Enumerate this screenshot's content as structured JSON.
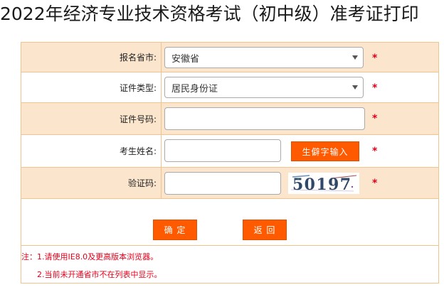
{
  "page": {
    "title": "2022年经济专业技术资格考试（初中级）准考证打印"
  },
  "form": {
    "province": {
      "label": "报名省市:",
      "value": "安徽省",
      "required_mark": "*"
    },
    "id_type": {
      "label": "证件类型:",
      "value": "居民身份证",
      "required_mark": "*"
    },
    "id_number": {
      "label": "证件号码:",
      "value": "",
      "required_mark": "*"
    },
    "name": {
      "label": "考生姓名:",
      "value": "",
      "rare_char_button": "生僻字输入",
      "required_mark": "*"
    },
    "captcha": {
      "label": "验证码:",
      "value": "",
      "code": "50197",
      "required_mark": "*"
    },
    "buttons": {
      "confirm": "确 定",
      "back": "返 回"
    }
  },
  "notes": {
    "line1": "注：1.请使用IE8.0及更高版本浏览器。",
    "line2": "2.当前未开通省市不在列表中显示。"
  },
  "colors": {
    "accent": "#ff5a00",
    "row_alt": "#fbe5cc",
    "border": "#f0c48c",
    "required": "#e2001a"
  }
}
